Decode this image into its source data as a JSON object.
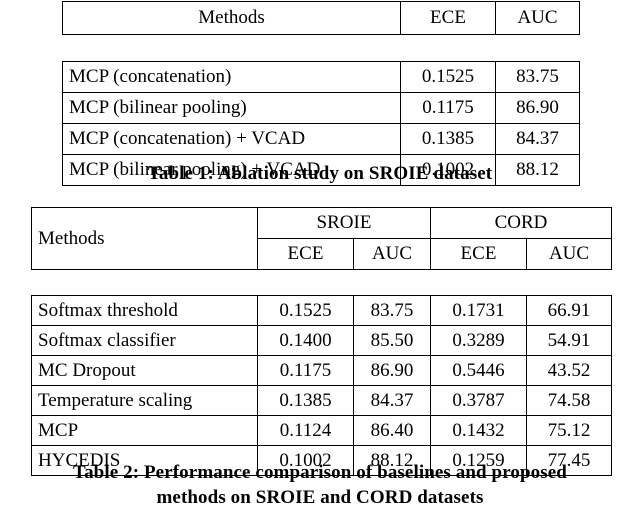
{
  "table1": {
    "columns": [
      "Methods",
      "ECE",
      "AUC"
    ],
    "rows": [
      {
        "method": "MCP (concatenation)",
        "ece": "0.1525",
        "auc": "83.75",
        "bold": false
      },
      {
        "method": "MCP (bilinear pooling)",
        "ece": "0.1175",
        "auc": "86.90",
        "bold": false
      },
      {
        "method": "MCP (concatenation) + VCAD",
        "ece": "0.1385",
        "auc": "84.37",
        "bold": false
      },
      {
        "method": "MCP (bilinear pooling) + VCAD",
        "ece": "0.1002",
        "auc": "88.12",
        "bold": true
      }
    ],
    "caption": "Table 1: Ablation study on SROIE dataset"
  },
  "table2": {
    "method_header": "Methods",
    "group_headers": [
      "SROIE",
      "CORD"
    ],
    "metric_headers": [
      "ECE",
      "AUC",
      "ECE",
      "AUC"
    ],
    "rows": [
      {
        "method": "Softmax threshold",
        "sroie_ece": "0.1525",
        "sroie_auc": "83.75",
        "cord_ece": "0.1731",
        "cord_auc": "66.91",
        "bold": false
      },
      {
        "method": "Softmax classifier",
        "sroie_ece": "0.1400",
        "sroie_auc": "85.50",
        "cord_ece": "0.3289",
        "cord_auc": "54.91",
        "bold": false
      },
      {
        "method": "MC Dropout",
        "sroie_ece": "0.1175",
        "sroie_auc": "86.90",
        "cord_ece": "0.5446",
        "cord_auc": "43.52",
        "bold": false
      },
      {
        "method": "Temperature scaling",
        "sroie_ece": "0.1385",
        "sroie_auc": "84.37",
        "cord_ece": "0.3787",
        "cord_auc": "74.58",
        "bold": false
      },
      {
        "method": "MCP",
        "sroie_ece": "0.1124",
        "sroie_auc": "86.40",
        "cord_ece": "0.1432",
        "cord_auc": "75.12",
        "bold": false
      },
      {
        "method": "HYCEDIS",
        "sroie_ece": "0.1002",
        "sroie_auc": "88.12",
        "cord_ece": "0.1259",
        "cord_auc": "77.45",
        "bold": true
      }
    ],
    "caption_line1": "Table 2: Performance comparison of baselines and proposed",
    "caption_line2": "methods on SROIE and CORD datasets"
  }
}
